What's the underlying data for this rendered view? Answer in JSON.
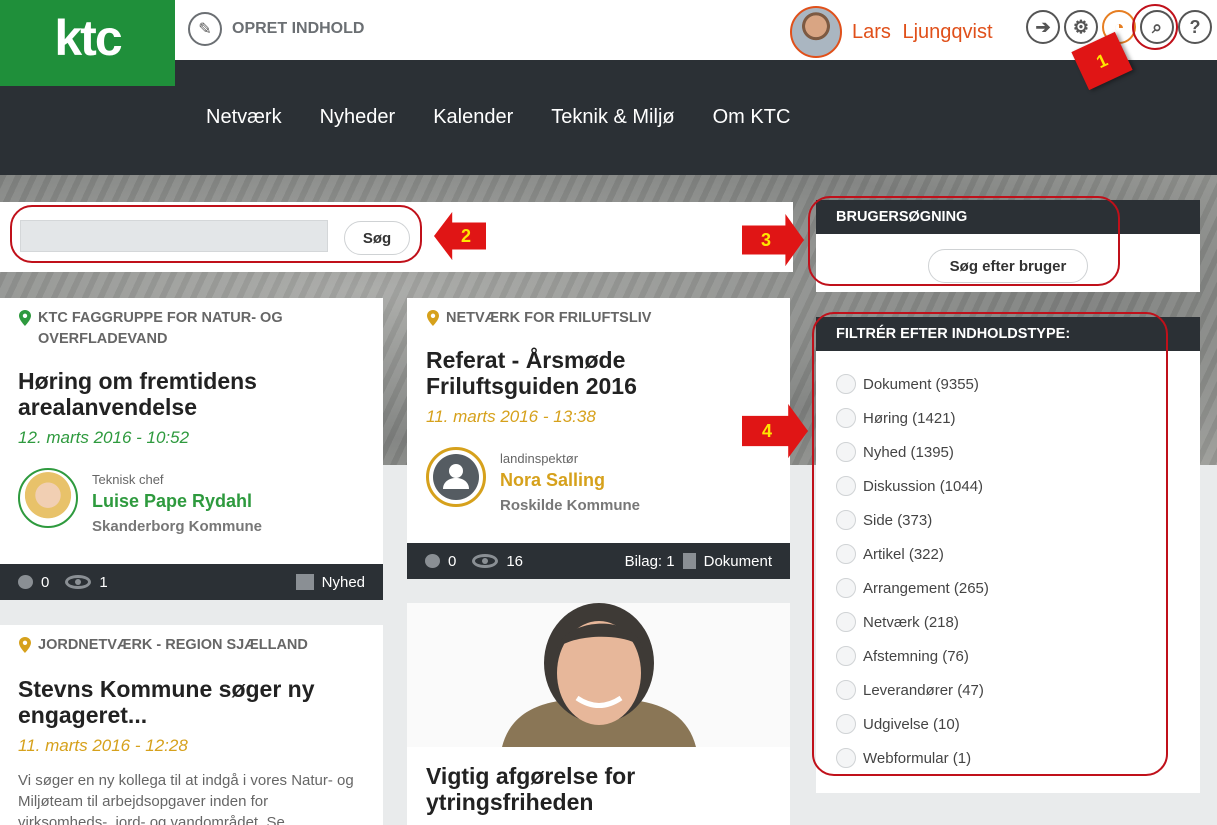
{
  "header": {
    "logo_text": "ktc",
    "create_label": "OPRET INDHOLD",
    "user_name": "Lars Ljungqvist"
  },
  "icons": [
    "arrow-right-icon",
    "gear-icon",
    "rss-icon",
    "search-icon",
    "help-icon"
  ],
  "nav": [
    "Netværk",
    "Nyheder",
    "Kalender",
    "Teknik & Miljø",
    "Om KTC"
  ],
  "search": {
    "placeholder": "",
    "button": "Søg"
  },
  "annotations": [
    "1",
    "2",
    "3",
    "4"
  ],
  "cards": [
    {
      "group": "KTC FAGGRUPPE FOR NATUR- OG OVERFLADEVAND",
      "title": "Høring om fremtidens arealanvendelse",
      "date": "12. marts 2016 - 10:52",
      "role": "Teknisk chef",
      "author": "Luise Pape Rydahl",
      "org": "Skanderborg Kommune",
      "comments": "0",
      "views": "1",
      "type": "Nyhed"
    },
    {
      "group": "NETVÆRK FOR FRILUFTSLIV",
      "title": "Referat - Årsmøde Friluftsguiden 2016",
      "date": "11. marts 2016 - 13:38",
      "role": "landinspektør",
      "author": "Nora Salling",
      "org": "Roskilde Kommune",
      "comments": "0",
      "views": "16",
      "attachments": "Bilag: 1",
      "type": "Dokument"
    },
    {
      "group": "JORDNETVÆRK - REGION SJÆLLAND",
      "title": "Stevns Kommune søger ny engageret...",
      "date": "11. marts 2016 - 12:28",
      "excerpt": "Vi søger en ny kollega til at indgå i vores Natur- og Miljøteam til arbejdsopgaver inden for virksomheds-, jord- og vandområdet. Se"
    },
    {
      "title": "Vigtig afgørelse for ytringsfriheden"
    }
  ],
  "user_search": {
    "heading": "BRUGERSØGNING",
    "button": "Søg efter bruger"
  },
  "filter": {
    "heading": "FILTRÉR EFTER INDHOLDSTYPE:",
    "items": [
      "Dokument (9355)",
      "Høring (1421)",
      "Nyhed (1395)",
      "Diskussion (1044)",
      "Side (373)",
      "Artikel (322)",
      "Arrangement (265)",
      "Netværk (218)",
      "Afstemning (76)",
      "Leverandører (47)",
      "Udgivelse (10)",
      "Webformular (1)"
    ]
  },
  "colors": {
    "brand_green": "#1f8f3a",
    "accent_orange": "#e0501a",
    "dark": "#2b3035",
    "date_green": "#2e9a3e",
    "date_yellow": "#d6a11c",
    "annotation_red": "#e01515"
  }
}
